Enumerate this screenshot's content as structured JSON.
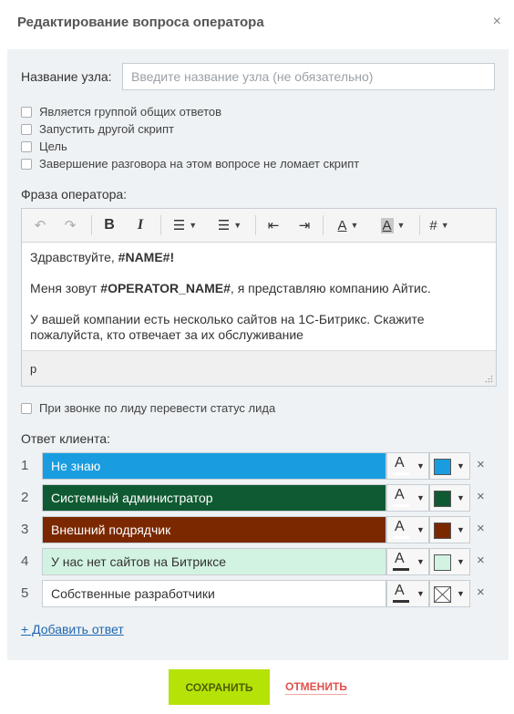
{
  "dialog": {
    "title": "Редактирование вопроса оператора",
    "close": "×"
  },
  "node_name": {
    "label": "Название узла:",
    "value": "",
    "placeholder": "Введите название узла (не обязательно)"
  },
  "options": [
    {
      "label": "Является группой общих ответов",
      "checked": false
    },
    {
      "label": "Запустить другой скрипт",
      "checked": false
    },
    {
      "label": "Цель",
      "checked": false
    },
    {
      "label": "Завершение разговора на этом вопросе не ломает скрипт",
      "checked": false
    }
  ],
  "operator_phrase": {
    "label": "Фраза оператора:",
    "toolbar": {
      "undo": "↶",
      "redo": "↷",
      "bold": "B",
      "italic": "I",
      "bullet_list": "☰",
      "numbered_list": "☰",
      "outdent": "⇤",
      "indent": "⇥",
      "text_color": "A",
      "bg_color": "A",
      "placeholder_menu": "#"
    },
    "content": {
      "p1_text": "Здравствуйте, ",
      "p1_bold": "#NAME#!",
      "p2_text_before": "Меня зовут  ",
      "p2_bold": "#OPERATOR_NAME#",
      "p2_text_after": ", я представляю компанию Айтис.",
      "p3_text": "У вашей компании есть несколько сайтов на 1С-Битрикс. Скажите пожалуйста, кто отвечает за их обслуживание"
    },
    "status_path": "p"
  },
  "lead_status": {
    "label": "При звонке по лиду перевести статус лида",
    "checked": false
  },
  "client_answers": {
    "label": "Ответ клиента:",
    "items": [
      {
        "num": "1",
        "text": "Не знаю",
        "bg": "#1a9de0",
        "fg": "#ffffff",
        "font_bar": "#ffffff",
        "swatch": "#1a9de0"
      },
      {
        "num": "2",
        "text": "Системный администратор",
        "bg": "#0f5a32",
        "fg": "#ffffff",
        "font_bar": "#ffffff",
        "swatch": "#0f5a32"
      },
      {
        "num": "3",
        "text": "Внешний подрядчик",
        "bg": "#7b2800",
        "fg": "#ffffff",
        "font_bar": "#ffffff",
        "swatch": "#7b2800"
      },
      {
        "num": "4",
        "text": "У нас нет сайтов на Битриксе",
        "bg": "#d3f3e2",
        "fg": "#333333",
        "font_bar": "#333333",
        "swatch": "#d3f3e2"
      },
      {
        "num": "5",
        "text": "Собственные разработчики",
        "bg": "#ffffff",
        "fg": "#333333",
        "font_bar": "#333333",
        "swatch": "none"
      }
    ],
    "add_label": "+ Добавить ответ"
  },
  "actions": {
    "save": "СОХРАНИТЬ",
    "cancel": "ОТМЕНИТЬ"
  },
  "icons": {
    "remove": "×",
    "caret": "▼"
  }
}
